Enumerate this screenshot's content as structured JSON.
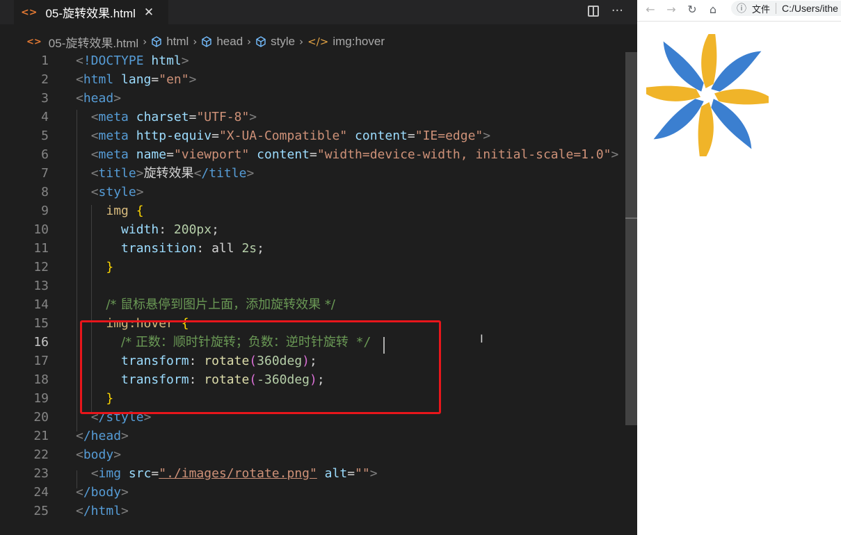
{
  "tab": {
    "file_icon": "<>",
    "title": "05-旋转效果.html",
    "close": "✕"
  },
  "tab_actions": {
    "more": "···"
  },
  "breadcrumb": {
    "items": [
      "05-旋转效果.html",
      "html",
      "head",
      "style",
      "img:hover"
    ]
  },
  "editor": {
    "active_line": 16,
    "line_numbers": [
      "1",
      "2",
      "3",
      "4",
      "5",
      "6",
      "7",
      "8",
      "9",
      "10",
      "11",
      "12",
      "13",
      "14",
      "15",
      "16",
      "17",
      "18",
      "19",
      "20",
      "21",
      "22",
      "23",
      "24",
      "25"
    ]
  },
  "code": {
    "l1_doctype": "!DOCTYPE",
    "l1_html": "html",
    "l2_tag": "html",
    "l2_attr": "lang",
    "l2_val": "\"en\"",
    "l3_tag": "head",
    "l4_tag": "meta",
    "l4_attr": "charset",
    "l4_val": "\"UTF-8\"",
    "l5_tag": "meta",
    "l5_attr1": "http-equiv",
    "l5_val1": "\"X-UA-Compatible\"",
    "l5_attr2": "content",
    "l5_val2": "\"IE=edge\"",
    "l6_tag": "meta",
    "l6_attr1": "name",
    "l6_val1": "\"viewport\"",
    "l6_attr2": "content",
    "l6_val2": "\"width=device-width, initial-scale=1.0\"",
    "l7_tag": "title",
    "l7_text": "旋转效果",
    "l7_close": "/title",
    "l8_tag": "style",
    "l9_sel": "img",
    "l10_prop": "width",
    "l10_val": "200px",
    "l11_prop": "transition",
    "l11_val1": "all",
    "l11_val2": "2s",
    "l14_comment": "/* 鼠标悬停到图片上面，添加旋转效果 */",
    "l15_sel": "img:hover",
    "l16_comment_a": "/* 正数：顺时针旋转；负数：逆时针旋转",
    "l16_comment_b": " */",
    "l17_prop": "transform",
    "l17_fn": "rotate",
    "l17_val": "360deg",
    "l18_prop": "transform",
    "l18_fn": "rotate",
    "l18_val": "-360deg",
    "l20_tag": "/style",
    "l21_tag": "/head",
    "l22_tag": "body",
    "l23_tag": "img",
    "l23_attr1": "src",
    "l23_val1": "\"./images/rotate.png\"",
    "l23_attr2": "alt",
    "l23_val2": "\"\"",
    "l24_tag": "/body",
    "l25_tag": "/html"
  },
  "browser": {
    "back": "←",
    "forward": "→",
    "reload": "↻",
    "home": "⌂",
    "info": "ⓘ",
    "file_label": "文件",
    "url": "C:/Users/ithe"
  },
  "colors": {
    "editor_bg": "#1e1e1e",
    "highlight_box": "#e8161b",
    "pinwheel_blue": "#3b7fd0",
    "pinwheel_yellow": "#f0b429"
  }
}
